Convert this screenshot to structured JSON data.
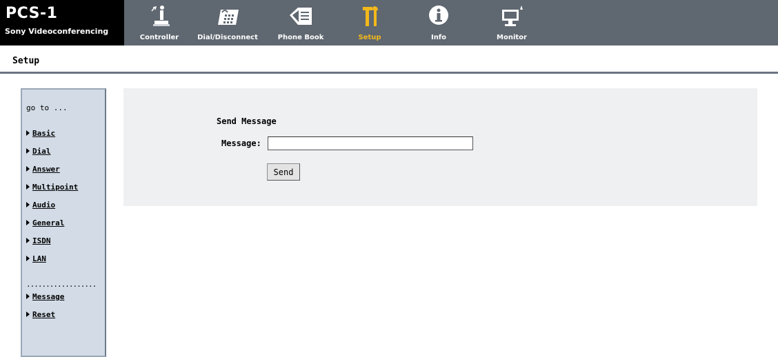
{
  "app": {
    "product": "PCS-1",
    "subtitle": "Sony Videoconferencing"
  },
  "nav": {
    "items": [
      {
        "label": "Controller",
        "icon": "controller-icon"
      },
      {
        "label": "Dial/Disconnect",
        "icon": "dial-phone-icon"
      },
      {
        "label": "Phone Book",
        "icon": "phone-book-icon"
      },
      {
        "label": "Setup",
        "icon": "setup-tools-icon",
        "active": true
      },
      {
        "label": "Info",
        "icon": "info-icon"
      },
      {
        "label": "Monitor",
        "icon": "monitor-icon"
      }
    ],
    "active_color": "#f2b81c"
  },
  "page": {
    "title": "Setup"
  },
  "sidebar": {
    "goto_label": "go to ...",
    "items": [
      {
        "label": "Basic"
      },
      {
        "label": "Dial"
      },
      {
        "label": "Answer"
      },
      {
        "label": "Multipoint"
      },
      {
        "label": "Audio"
      },
      {
        "label": "General"
      },
      {
        "label": "ISDN"
      },
      {
        "label": "LAN"
      }
    ],
    "separator": "..................",
    "extra_items": [
      {
        "label": "Message"
      },
      {
        "label": "Reset"
      }
    ]
  },
  "form": {
    "heading": "Send Message",
    "message_label": "Message:",
    "message_value": "",
    "send_label": "Send"
  },
  "colors": {
    "topbar": "#5f6770",
    "sidebar_bg": "#d2dbe6",
    "panel_bg": "#eef0f2"
  }
}
